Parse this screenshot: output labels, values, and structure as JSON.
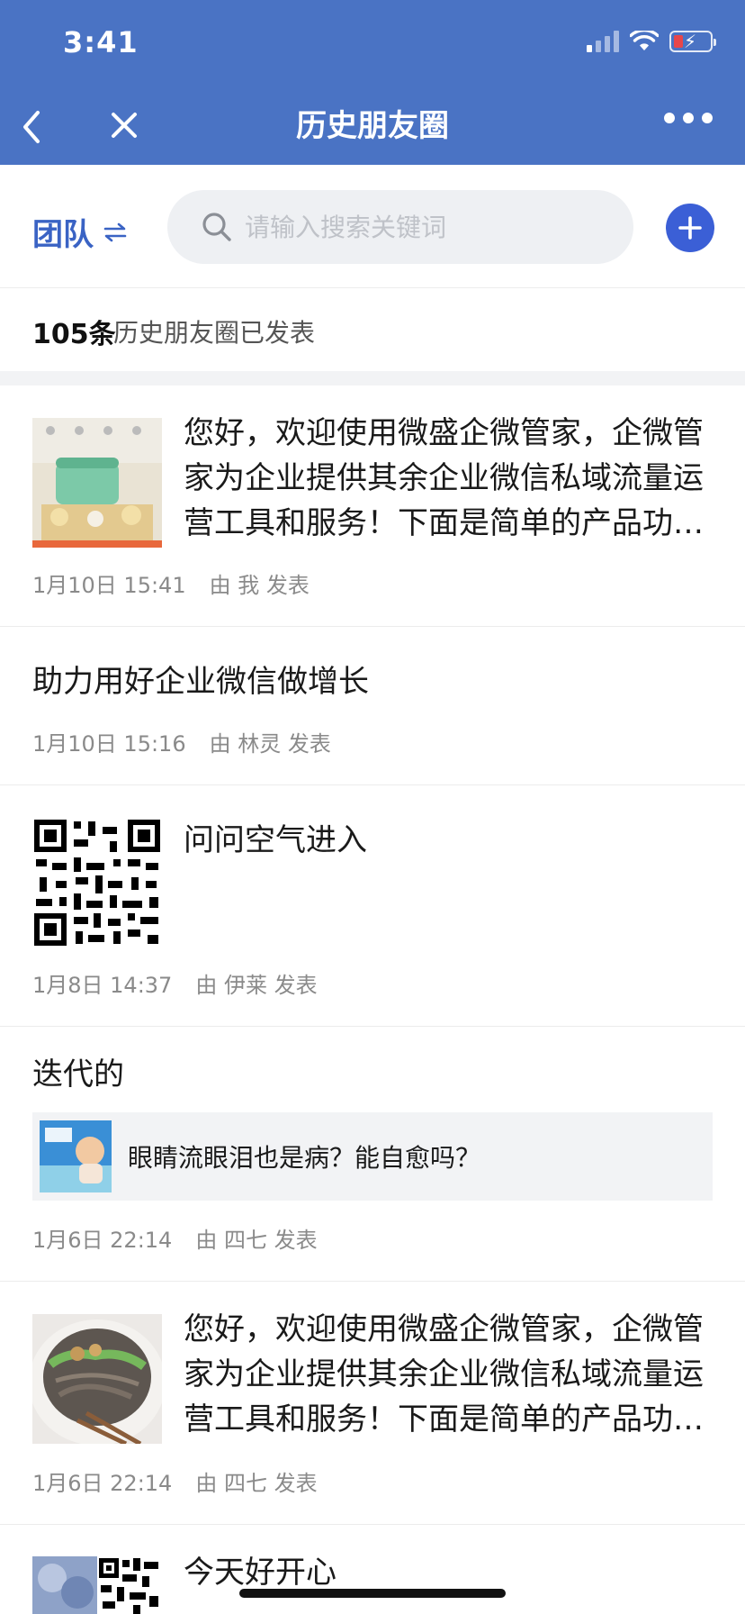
{
  "status_bar": {
    "time": "3:41"
  },
  "nav": {
    "title": "历史朋友圈"
  },
  "filter": {
    "team_label": "团队",
    "search_placeholder": "请输入搜索关键词"
  },
  "summary": {
    "count": "105条",
    "label": "历史朋友圈已发表"
  },
  "colors": {
    "header": "#4a73c4",
    "accent": "#3a63c4",
    "add_button": "#3b5fd6"
  },
  "posts": [
    {
      "text": "您好，欢迎使用微盛企微管家，企微管家为企业提供其余企业微信私域流量运营工具和服务！下面是简单的产品功能介绍",
      "time": "1月10日 15:41",
      "by": "由 我 发表",
      "image": "product-photo"
    },
    {
      "text": "助力用好企业微信做增长",
      "time": "1月10日 15:16",
      "by": "由 林灵 发表"
    },
    {
      "text": "问问空气进入",
      "time": "1月8日 14:37",
      "by": "由 伊莱 发表",
      "image": "qr-code"
    },
    {
      "text": "迭代的",
      "time": "1月6日 22:14",
      "by": "由 四七 发表",
      "link_title": "眼睛流眼泪也是病？能自愈吗？"
    },
    {
      "text": "您好，欢迎使用微盛企微管家，企微管家为企业提供其余企业微信私域流量运营工具和服务！下面是简单的产品功能介绍",
      "time": "1月6日 22:14",
      "by": "由 四七 发表",
      "image": "noodle-photo"
    },
    {
      "text": "今天好开心",
      "image": "collage"
    }
  ]
}
